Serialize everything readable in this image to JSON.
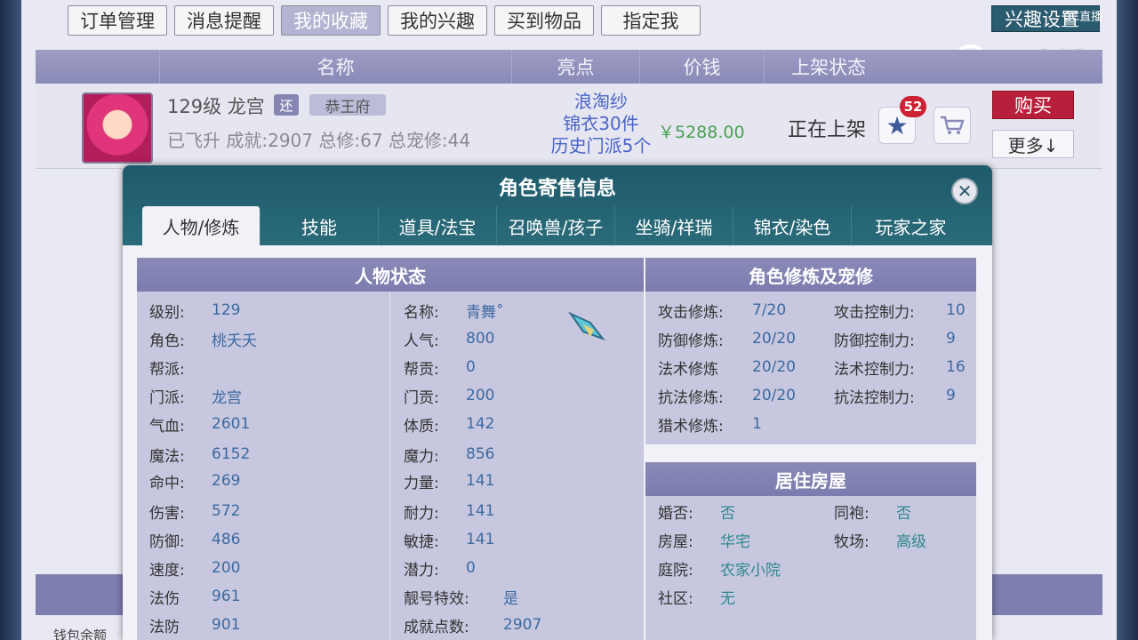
{
  "topnav": [
    "订单管理",
    "消息提醒",
    "我的收藏",
    "我的兴趣",
    "买到物品",
    "指定我"
  ],
  "interest_button": "兴趣设置",
  "cc_small": "CC直播",
  "cc_logo": "CC直播",
  "table_headers": [
    "名称",
    "亮点",
    "价钱",
    "上架状态"
  ],
  "listing": {
    "level_name": "129级 龙宫",
    "tag": "还",
    "server": "恭王府",
    "sub": "已飞升 成就:2907 总修:67 总宠修:44",
    "highlights": [
      "浪淘纱",
      "锦衣30件",
      "历史门派5个"
    ],
    "price": "￥5288.00",
    "state": "正在上架",
    "fav_count": "52",
    "buy": "购买",
    "more": "更多↓"
  },
  "bottom_text": "钱包余额",
  "modal": {
    "title": "角色寄售信息",
    "tabs": [
      "人物/修炼",
      "技能",
      "道具/法宝",
      "召唤兽/孩子",
      "坐骑/祥瑞",
      "锦衣/染色",
      "玩家之家"
    ],
    "status_title": "人物状态",
    "left_col": [
      [
        "级别:",
        "129"
      ],
      [
        "角色:",
        "桃夭夭"
      ],
      [
        "帮派:",
        ""
      ],
      [
        "门派:",
        "龙宫"
      ],
      [
        "气血:",
        "2601"
      ],
      [
        "魔法:",
        "6152"
      ],
      [
        "命中:",
        "269"
      ],
      [
        "伤害:",
        "572"
      ],
      [
        "防御:",
        "486"
      ],
      [
        "速度:",
        "200"
      ],
      [
        "法伤",
        "961"
      ],
      [
        "法防",
        "901"
      ]
    ],
    "mid_col": [
      [
        "名称:",
        "青舞˚"
      ],
      [
        "人气:",
        "800"
      ],
      [
        "帮贡:",
        "0"
      ],
      [
        "门贡:",
        "200"
      ],
      [
        "体质:",
        "142"
      ],
      [
        "魔力:",
        "856"
      ],
      [
        "力量:",
        "141"
      ],
      [
        "耐力:",
        "141"
      ],
      [
        "敏捷:",
        "141"
      ],
      [
        "潜力:",
        "0"
      ],
      [
        "靓号特效:",
        "是"
      ],
      [
        "成就点数:",
        "2907"
      ]
    ],
    "cultivation_title": "角色修炼及宠修",
    "cultivation": [
      [
        "攻击修炼:",
        "7/20",
        "攻击控制力:",
        "10"
      ],
      [
        "防御修炼:",
        "20/20",
        "防御控制力:",
        "9"
      ],
      [
        "法术修炼",
        "20/20",
        "法术控制力:",
        "16"
      ],
      [
        "抗法修炼:",
        "20/20",
        "抗法控制力:",
        "9"
      ],
      [
        "猎术修炼:",
        "1",
        "",
        ""
      ]
    ],
    "house_title": "居住房屋",
    "house": [
      [
        "婚否:",
        "否",
        "同袍:",
        "否"
      ],
      [
        "房屋:",
        "华宅",
        "牧场:",
        "高级"
      ],
      [
        "庭院:",
        "农家小院",
        "",
        ""
      ],
      [
        "社区:",
        "无",
        "",
        ""
      ]
    ]
  }
}
